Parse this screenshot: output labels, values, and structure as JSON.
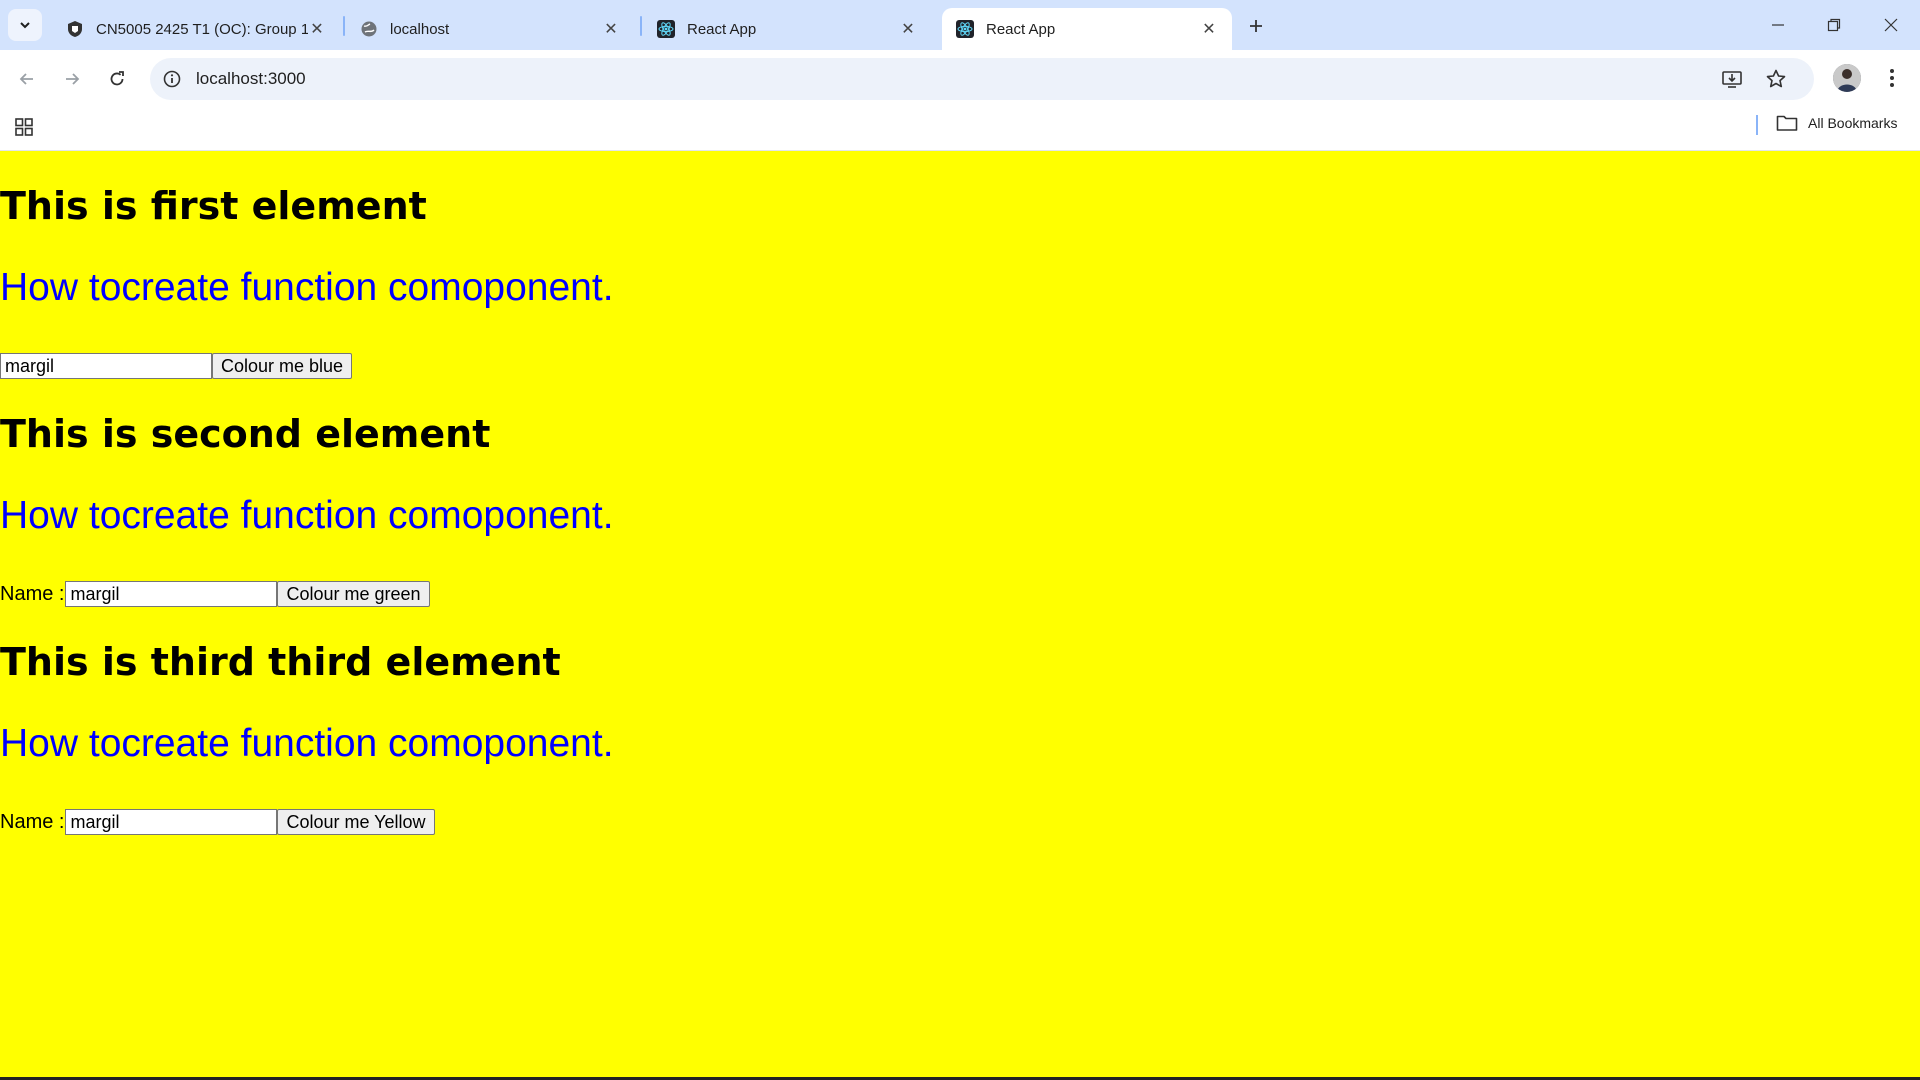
{
  "browser": {
    "tabs": [
      {
        "title": "CN5005 2425 T1 (OC): Group 1",
        "favicon": "shield-icon",
        "active": false
      },
      {
        "title": "localhost",
        "favicon": "globe-icon",
        "active": false
      },
      {
        "title": "React App",
        "favicon": "react-icon",
        "active": false
      },
      {
        "title": "React App",
        "favicon": "react-icon",
        "active": true
      }
    ],
    "url": "localhost:3000",
    "all_bookmarks_label": "All Bookmarks",
    "accent_color": "#d3e3fd"
  },
  "page": {
    "background": "#ffff00",
    "sections": [
      {
        "heading": "This is first element",
        "text": "How tocreate function comoponent.",
        "label": "",
        "input_value": "margil",
        "button_label": "Colour me blue"
      },
      {
        "heading": "This is second element",
        "text": "How tocreate function comoponent.",
        "label": "Name :",
        "input_value": "margil",
        "button_label": "Colour me green"
      },
      {
        "heading": "This is third third element",
        "text": "How tocreate function comoponent.",
        "label": "Name :",
        "input_value": "margil",
        "button_label": "Colour me Yellow"
      }
    ]
  }
}
